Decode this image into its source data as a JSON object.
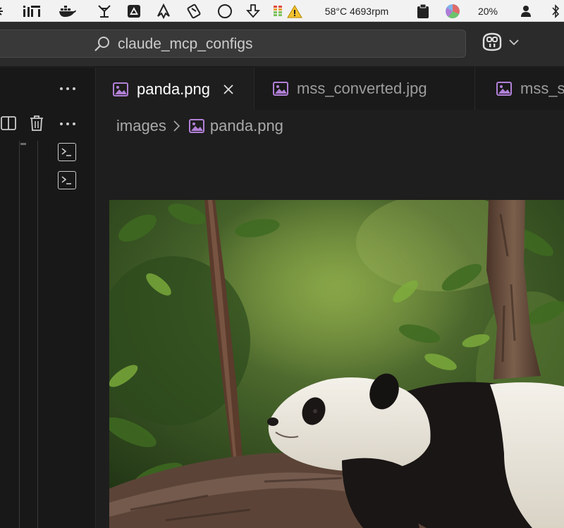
{
  "menubar": {
    "items": [
      {
        "name": "gear-status-icon"
      },
      {
        "name": "istat-menus-icon"
      },
      {
        "name": "docker-icon"
      },
      {
        "name": "bartender-icon"
      },
      {
        "name": "google-drive-icon"
      },
      {
        "name": "arc-launcher-icon"
      },
      {
        "name": "clipboard-app-icon"
      },
      {
        "name": "circle-status-icon"
      },
      {
        "name": "download-arrow-icon"
      },
      {
        "name": "battery-warning-icon"
      }
    ],
    "temperature_text": "58°C 4693rpm",
    "battery_percent": "20%"
  },
  "titlebar": {
    "search_text": "claude_mcp_configs"
  },
  "tabs": [
    {
      "label": "panda.png",
      "active": true,
      "icon": "image-file-icon"
    },
    {
      "label": "mss_converted.jpg",
      "active": false,
      "icon": "image-file-icon"
    },
    {
      "label": "mss_s",
      "active": false,
      "icon": "image-file-icon"
    }
  ],
  "breadcrumb": {
    "folder": "images",
    "file": "panda.png"
  },
  "colors": {
    "accent_image_icon": "#b180d7",
    "editor_bg": "#1e1e1e",
    "titlebar_bg": "#2b2b2b"
  }
}
